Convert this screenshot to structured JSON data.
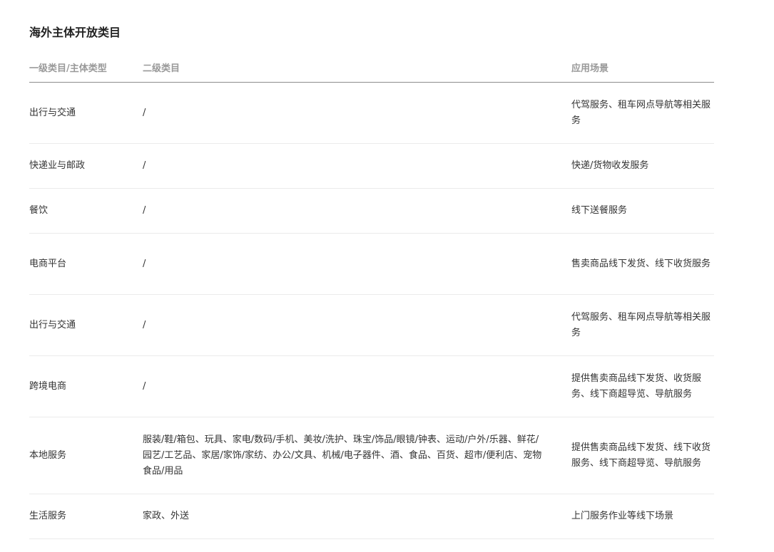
{
  "title": "海外主体开放类目",
  "table": {
    "headers": {
      "primary": "一级类目/主体类型",
      "secondary": "二级类目",
      "scenario": "应用场景"
    },
    "rows": [
      {
        "primary": "出行与交通",
        "secondary": "/",
        "scenario": "代驾服务、租车网点导航等相关服务"
      },
      {
        "primary": "快递业与邮政",
        "secondary": "/",
        "scenario": "快递/货物收发服务"
      },
      {
        "primary": "餐饮",
        "secondary": "/",
        "scenario": "线下送餐服务"
      },
      {
        "primary": "电商平台",
        "secondary": "/",
        "scenario": "售卖商品线下发货、线下收货服务"
      },
      {
        "primary": "出行与交通",
        "secondary": "/",
        "scenario": "代驾服务、租车网点导航等相关服务"
      },
      {
        "primary": "跨境电商",
        "secondary": "/",
        "scenario": "提供售卖商品线下发货、收货服务、线下商超导览、导航服务"
      },
      {
        "primary": "本地服务",
        "secondary": "服装/鞋/箱包、玩具、家电/数码/手机、美妆/洗护、珠宝/饰品/眼镜/钟表、运动/户外/乐器、鲜花/园艺/工艺品、家居/家饰/家纺、办公/文具、机械/电子器件、酒、食品、百货、超市/便利店、宠物食品/用品",
        "scenario": "提供售卖商品线下发货、线下收货服务、线下商超导览、导航服务"
      },
      {
        "primary": "生活服务",
        "secondary": "家政、外送",
        "scenario": "上门服务作业等线下场景"
      }
    ]
  }
}
